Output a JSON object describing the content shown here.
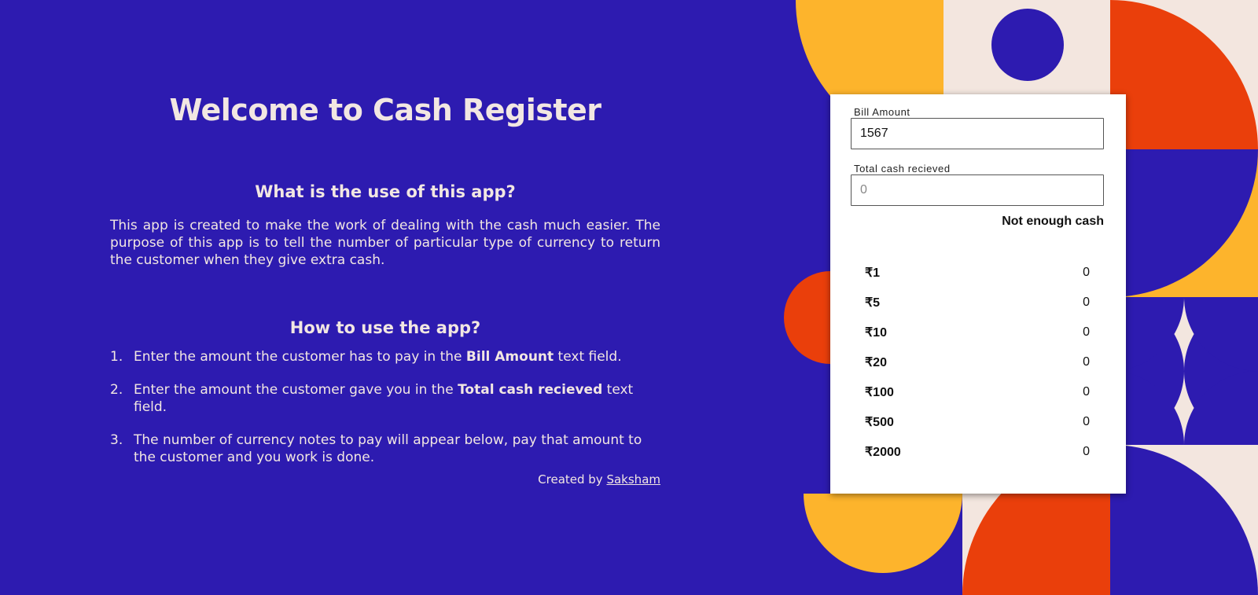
{
  "heading": "Welcome to Cash Register",
  "about": {
    "title": "What is the use of this app?",
    "text": "This app is created to make the work of dealing with the cash much easier. The purpose of this app is to tell the number of particular type of currency to return the customer when they give extra cash."
  },
  "how": {
    "title": "How to use the app?",
    "steps": [
      {
        "num": "1.",
        "pre": "Enter the amount the customer has to pay in the ",
        "bold": "Bill Amount",
        "post": " text field."
      },
      {
        "num": "2.",
        "pre": "Enter the amount the customer gave you in the ",
        "bold": "Total cash recieved",
        "post": " text field."
      },
      {
        "num": "3.",
        "pre": "The number of currency notes to pay will appear below, pay that amount to the customer and you work is done.",
        "bold": "",
        "post": ""
      }
    ]
  },
  "credit": {
    "prefix": "Created by ",
    "author": "Saksham"
  },
  "form": {
    "bill_label": "Bill Amount",
    "bill_value": "1567",
    "cash_label": "Total cash recieved",
    "cash_placeholder": "0",
    "cash_value": "",
    "message": "Not enough cash",
    "notes": [
      {
        "label": "₹1",
        "count": "0"
      },
      {
        "label": "₹5",
        "count": "0"
      },
      {
        "label": "₹10",
        "count": "0"
      },
      {
        "label": "₹20",
        "count": "0"
      },
      {
        "label": "₹100",
        "count": "0"
      },
      {
        "label": "₹500",
        "count": "0"
      },
      {
        "label": "₹2000",
        "count": "0"
      }
    ]
  },
  "colors": {
    "background": "#2d1bb0",
    "text": "#f2e7e2",
    "yellow": "#fdb42c",
    "orange": "#ea3f0b",
    "cream": "#f3e6df",
    "blue": "#2d1bb0"
  }
}
